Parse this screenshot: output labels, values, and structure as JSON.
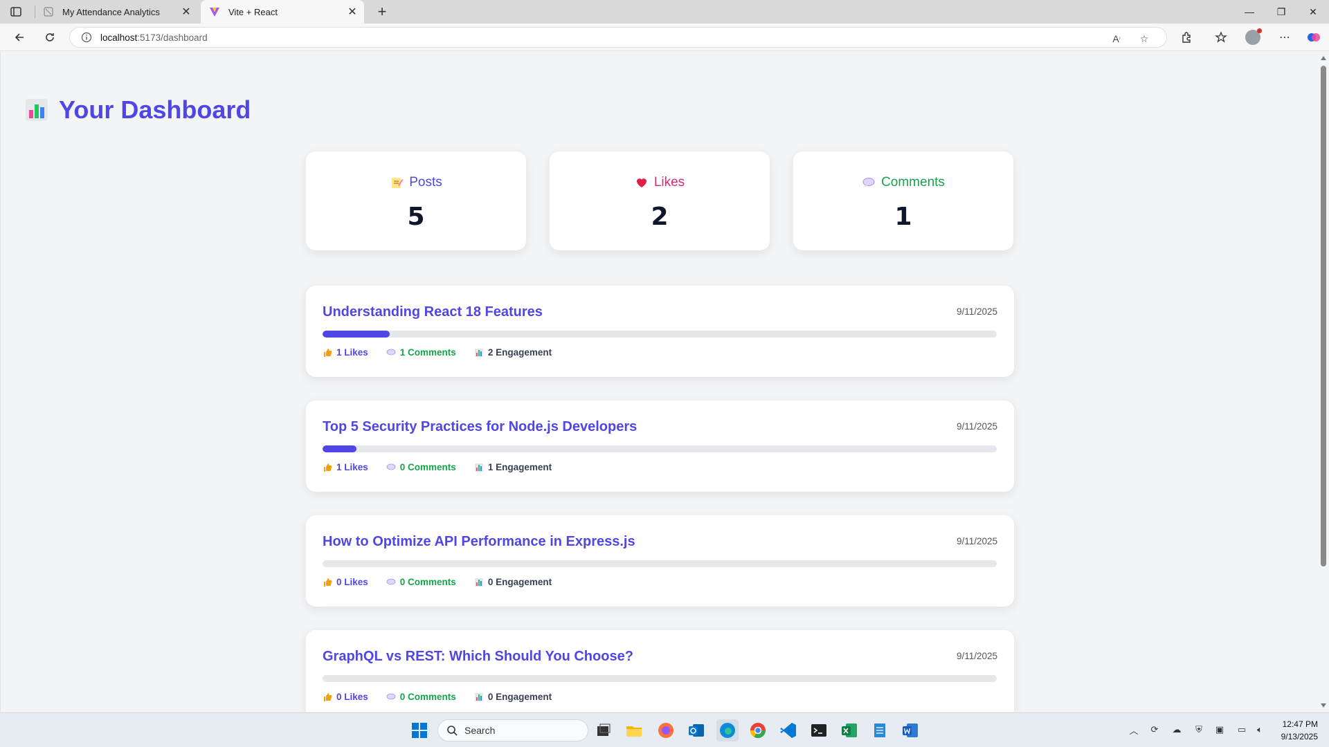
{
  "browser": {
    "tabs": [
      {
        "title": "My Attendance Analytics",
        "active": false
      },
      {
        "title": "Vite + React",
        "active": true
      }
    ],
    "address": {
      "host": "localhost",
      "path": ":5173/dashboard"
    }
  },
  "dashboard": {
    "title": "Your Dashboard",
    "stats": [
      {
        "label": "Posts",
        "value": "5",
        "color": "#4f46e5",
        "icon": "memo-icon"
      },
      {
        "label": "Likes",
        "value": "2",
        "color": "#db2777",
        "icon": "heart-icon"
      },
      {
        "label": "Comments",
        "value": "1",
        "color": "#16a34a",
        "icon": "speech-bubble-icon"
      }
    ],
    "posts": [
      {
        "title": "Understanding React 18 Features",
        "date": "9/11/2025",
        "likes": "1 Likes",
        "comments": "1 Comments",
        "engagement": "2 Engagement",
        "engagement_fraction": 0.1
      },
      {
        "title": "Top 5 Security Practices for Node.js Developers",
        "date": "9/11/2025",
        "likes": "1 Likes",
        "comments": "0 Comments",
        "engagement": "1 Engagement",
        "engagement_fraction": 0.05
      },
      {
        "title": "How to Optimize API Performance in Express.js",
        "date": "9/11/2025",
        "likes": "0 Likes",
        "comments": "0 Comments",
        "engagement": "0 Engagement",
        "engagement_fraction": 0
      },
      {
        "title": "GraphQL vs REST: Which Should You Choose?",
        "date": "9/11/2025",
        "likes": "0 Likes",
        "comments": "0 Comments",
        "engagement": "0 Engagement",
        "engagement_fraction": 0
      }
    ]
  },
  "taskbar": {
    "search_placeholder": "Search",
    "time": "12:47 PM",
    "date": "9/13/2025"
  }
}
